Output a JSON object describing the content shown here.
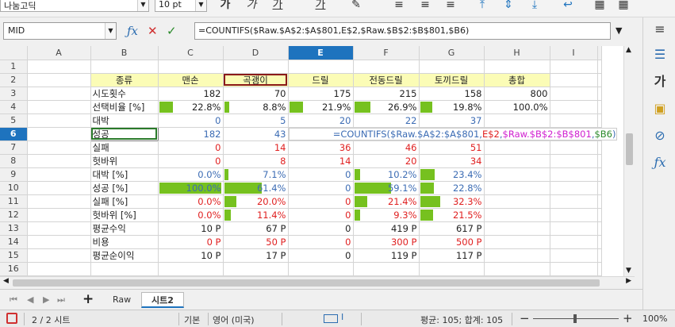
{
  "toolbar": {
    "font_name": "나눔고딕",
    "font_size": "10 pt"
  },
  "formula_bar": {
    "name_box": "MID",
    "formula": "=COUNTIFS($Raw.$A$2:$A$801,E$2,$Raw.$B$2:$B$801,$B6)"
  },
  "columns": [
    "A",
    "B",
    "C",
    "D",
    "E",
    "F",
    "G",
    "H",
    "I"
  ],
  "selected_column": "E",
  "rows": [
    "1",
    "2",
    "3",
    "4",
    "5",
    "6",
    "7",
    "8",
    "9",
    "10",
    "11",
    "12",
    "13",
    "14",
    "15",
    "16"
  ],
  "selected_row": "6",
  "header_row": [
    "종류",
    "맨손",
    "곡괭이",
    "드릴",
    "전동드릴",
    "토끼드릴",
    "총합"
  ],
  "table": [
    {
      "label": "시도횟수",
      "c": "182",
      "d": "70",
      "e": "175",
      "f": "215",
      "g": "158",
      "h": "800",
      "color": "black"
    },
    {
      "label": "선택비율 [%]",
      "c": "22.8%",
      "d": "8.8%",
      "e": "21.9%",
      "f": "26.9%",
      "g": "19.8%",
      "h": "100.0%",
      "color": "black",
      "bars": [
        0.228,
        0.088,
        0.219,
        0.269,
        0.198
      ]
    },
    {
      "label": "대박",
      "c": "0",
      "d": "5",
      "e": "20",
      "f": "22",
      "g": "37",
      "color": "blue"
    },
    {
      "label": "성공",
      "c": "182",
      "d": "43",
      "color": "blue"
    },
    {
      "label": "실패",
      "c": "0",
      "d": "14",
      "e": "36",
      "f": "46",
      "g": "51",
      "color": "red"
    },
    {
      "label": "헛바위",
      "c": "0",
      "d": "8",
      "e": "14",
      "f": "20",
      "g": "34",
      "color": "red"
    },
    {
      "label": "대박 [%]",
      "c": "0.0%",
      "d": "7.1%",
      "e": "0",
      "f": "10.2%",
      "g": "23.4%",
      "color": "blue",
      "bars": [
        0.0,
        0.071,
        0,
        0.102,
        0.234
      ]
    },
    {
      "label": "성공 [%]",
      "c": "100.0%",
      "d": "61.4%",
      "e": "0",
      "f": "59.1%",
      "g": "22.8%",
      "color": "blue",
      "bars": [
        1.0,
        0.614,
        0,
        0.591,
        0.228
      ]
    },
    {
      "label": "실패 [%]",
      "c": "0.0%",
      "d": "20.0%",
      "e": "0",
      "f": "21.4%",
      "g": "32.3%",
      "color": "red",
      "bars": [
        0.0,
        0.2,
        0,
        0.214,
        0.323
      ]
    },
    {
      "label": "헛바위 [%]",
      "c": "0.0%",
      "d": "11.4%",
      "e": "0",
      "f": "9.3%",
      "g": "21.5%",
      "color": "red",
      "bars": [
        0.0,
        0.114,
        0,
        0.093,
        0.215
      ]
    },
    {
      "label": "평균수익",
      "c": "10 P",
      "d": "67 P",
      "e": "0",
      "f": "419 P",
      "g": "617 P",
      "color": "black"
    },
    {
      "label": "비용",
      "c": "0 P",
      "d": "50 P",
      "e": "0",
      "f": "300 P",
      "g": "500 P",
      "color": "red"
    },
    {
      "label": "평균순이익",
      "c": "10 P",
      "d": "17 P",
      "e": "0",
      "f": "119 P",
      "g": "117 P",
      "color": "black"
    }
  ],
  "sheet_tabs": [
    "Raw",
    "시트2"
  ],
  "active_tab": "시트2",
  "status": {
    "sheet": "2 / 2 시트",
    "style": "기본",
    "language": "영어 (미국)",
    "summary": "평균: 105; 합계: 105",
    "zoom": "100%"
  },
  "colors": {
    "accent": "#1e73be",
    "bar": "#76c11f",
    "header_fill": "#fbfcb6",
    "blue": "#3c6cb4",
    "red": "#e02020"
  }
}
